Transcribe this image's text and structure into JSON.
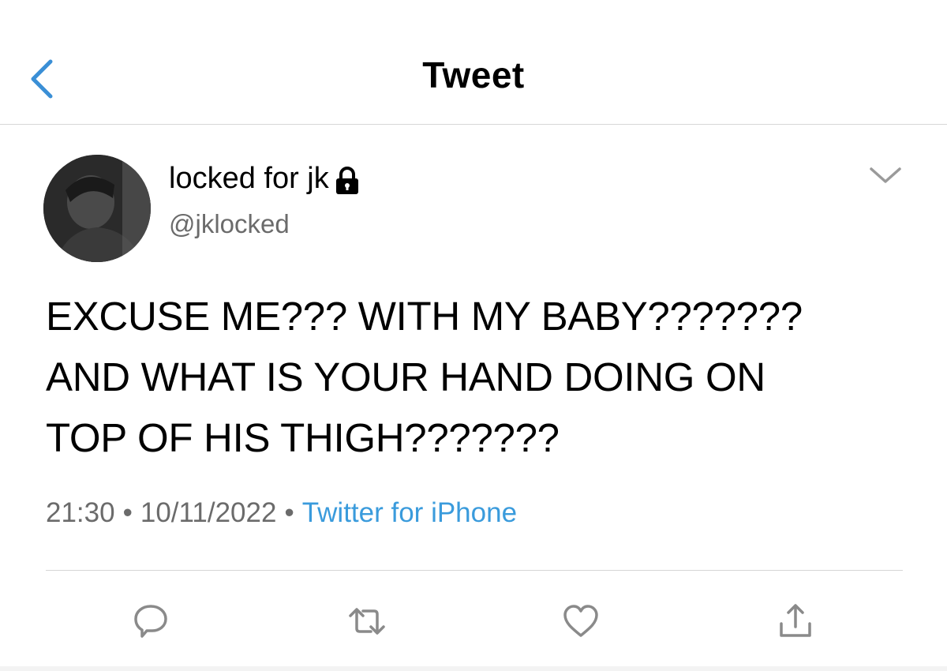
{
  "nav": {
    "title": "Tweet",
    "back_icon": "chevron-left-icon"
  },
  "author": {
    "display_name": "locked for jk",
    "handle": "@jklocked",
    "protected_icon": "lock-icon"
  },
  "tweet": {
    "text": "EXCUSE ME??? WITH MY BABY???????\nAND WHAT IS YOUR HAND DOING ON\nTOP OF HIS THIGH???????",
    "time": "21:30",
    "date": "10/11/2022",
    "separator": "•",
    "source": "Twitter for iPhone"
  },
  "actions": {
    "reply_icon": "reply-icon",
    "retweet_icon": "retweet-icon",
    "like_icon": "heart-icon",
    "share_icon": "share-icon"
  },
  "colors": {
    "accent": "#3a9bdc",
    "icon_gray": "#8a8a8a",
    "secondary_text": "#6b6b6b",
    "divider": "#d6d6d6"
  }
}
